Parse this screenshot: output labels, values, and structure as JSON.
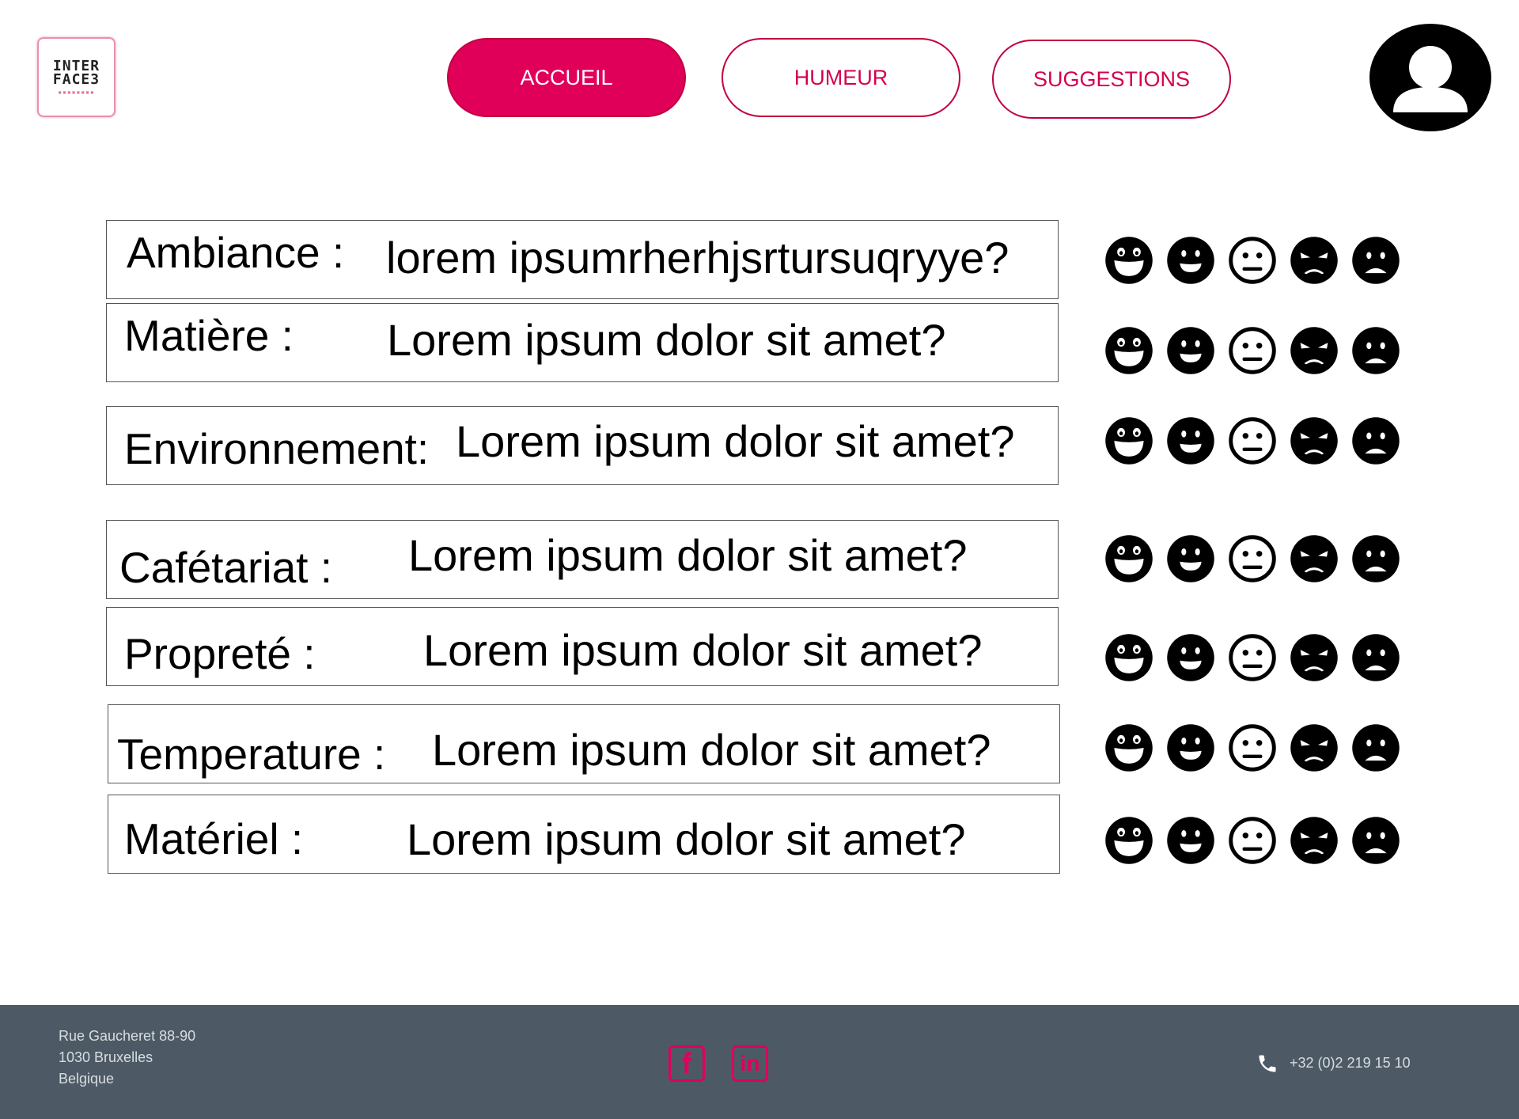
{
  "header": {
    "logo": {
      "line1": "INTER",
      "line2": "FACE3",
      "tagline": "▪▪▪▪▪▪▪▪"
    },
    "nav": {
      "accueil": "ACCUEIL",
      "humeur": "HUMEUR",
      "suggestions": "SUGGESTIONS"
    },
    "avatar_icon": "user-avatar-icon"
  },
  "questions": [
    {
      "label": "Ambiance :",
      "text": "lorem ipsumrherhjsrtursuqryye?"
    },
    {
      "label": "Matière :",
      "text": "Lorem ipsum dolor sit amet?"
    },
    {
      "label": "Environnement:",
      "text": "Lorem ipsum dolor sit amet?"
    },
    {
      "label": "Cafétariat :",
      "text": "Lorem ipsum dolor sit amet?"
    },
    {
      "label": "Propreté :",
      "text": "Lorem ipsum dolor sit amet?"
    },
    {
      "label": "Temperature :",
      "text": "Lorem ipsum dolor sit amet?"
    },
    {
      "label": "Matériel :",
      "text": "Lorem ipsum dolor sit amet?"
    }
  ],
  "mood_icons": [
    "grinning-face-icon",
    "smiling-face-icon",
    "neutral-face-icon",
    "angry-face-icon",
    "sad-face-icon"
  ],
  "footer": {
    "address": [
      "Rue Gaucheret 88-90",
      "1030 Bruxelles",
      "Belgique"
    ],
    "phone": "+32 (0)2 219 15 10",
    "social": {
      "facebook": "f",
      "linkedin": "in"
    }
  },
  "colors": {
    "accent": "#e0005a",
    "footer_bg": "#4d5a65",
    "footer_text": "#d8dde2"
  }
}
